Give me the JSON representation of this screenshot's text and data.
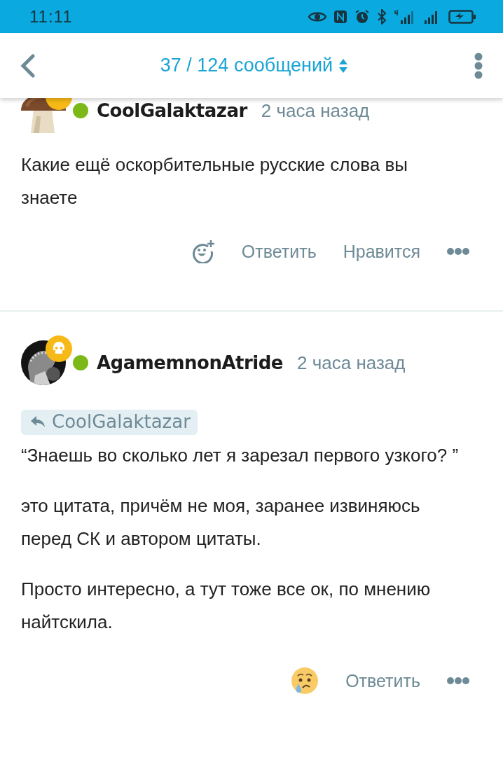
{
  "status_bar": {
    "time": "11:11"
  },
  "header": {
    "title": "37 / 124 сообщений"
  },
  "posts": [
    {
      "author": "CoolGalaktazar",
      "online": true,
      "time": "2 часа назад",
      "paragraphs": [
        "Какие ещё оскорбительные русские слова вы знаете"
      ],
      "actions": [
        {
          "kind": "add-reaction"
        },
        {
          "kind": "text",
          "label": "Ответить"
        },
        {
          "kind": "text",
          "label": "Нравится"
        },
        {
          "kind": "more"
        }
      ]
    },
    {
      "author": "AgamemnonAtride",
      "online": true,
      "time": "2 часа назад",
      "reply_to": "CoolGalaktazar",
      "paragraphs": [
        "“Знаешь во сколько лет я зарезал первого узкого? ”",
        "это цитата, причём не моя, заранее извиняюсь перед СК и автором цитаты.",
        "Просто интересно, а тут тоже все ок, по мнению найтскила."
      ],
      "actions": [
        {
          "kind": "crying-emoji"
        },
        {
          "kind": "text",
          "label": "Ответить"
        },
        {
          "kind": "more"
        }
      ]
    }
  ]
}
